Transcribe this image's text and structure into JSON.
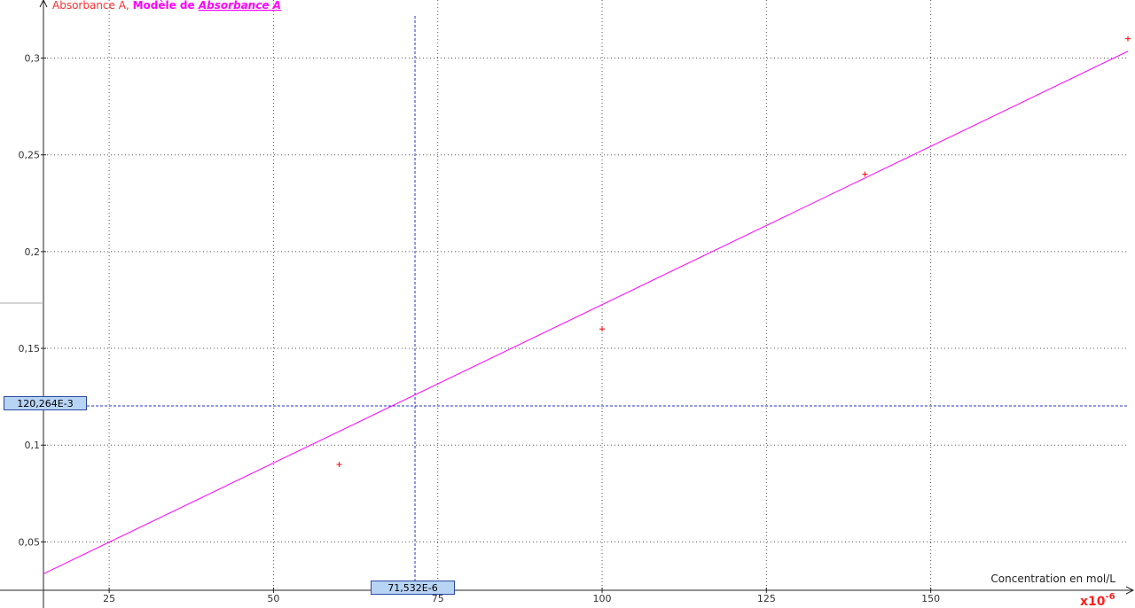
{
  "chart_data": {
    "type": "scatter",
    "title_parts": [
      "Absorbance A, ",
      "Modèle de ",
      "Absorbance A"
    ],
    "xlabel": "Concentration en mol/L",
    "x_multiplier": "x10",
    "x_multiplier_exp": "-6",
    "xlim": [
      15,
      180
    ],
    "ylim": [
      0.025,
      0.33
    ],
    "x_ticks": [
      25,
      50,
      75,
      100,
      125,
      150
    ],
    "x_tick_labels": [
      "25",
      "50",
      "75",
      "100",
      "125",
      "150"
    ],
    "y_ticks": [
      0.05,
      0.1,
      0.15,
      0.2,
      0.25,
      0.3
    ],
    "y_tick_labels": [
      "0,05",
      "0,1",
      "0,15",
      "0,2",
      "0,25",
      "0,3"
    ],
    "grid": true,
    "series": [
      {
        "name": "Absorbance A",
        "color": "#ff0000",
        "marker": "+",
        "x": [
          60,
          100,
          140,
          180
        ],
        "y": [
          0.09,
          0.16,
          0.24,
          0.31
        ]
      },
      {
        "name": "Modèle de Absorbance A",
        "color": "#ff00ff",
        "line": true,
        "x": [
          15,
          180
        ],
        "y": [
          0.0335,
          0.3035
        ]
      }
    ],
    "cursor": {
      "x": 71.532,
      "y": 0.120264,
      "x_label": "71,532E-6",
      "y_label": "120,264E-3",
      "color": "#2233cc"
    }
  }
}
